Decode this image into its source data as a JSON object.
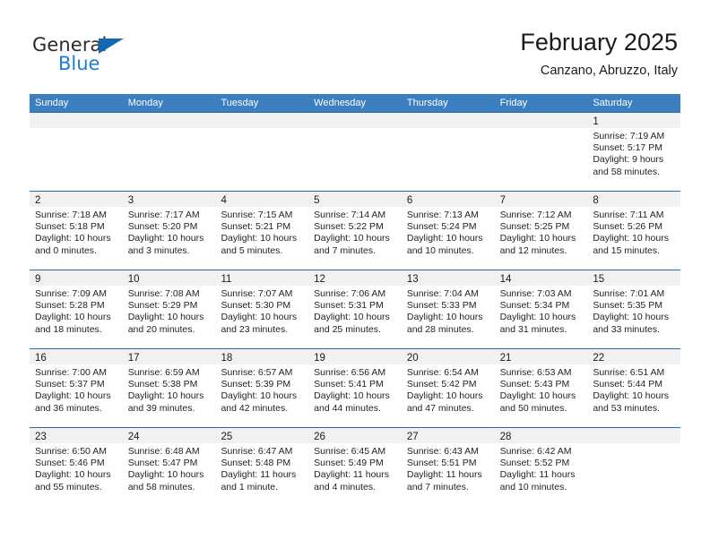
{
  "brand": {
    "name_top": "General",
    "name_bottom": "Blue",
    "triangle_color": "#1268b3",
    "blue_color": "#1a7fd4"
  },
  "header": {
    "title": "February 2025",
    "subtitle": "Canzano, Abruzzo, Italy"
  },
  "theme": {
    "header_blue": "#3c7fc1",
    "row_divider_blue": "#2b6ca8",
    "day_band_gray": "#f1f1f1"
  },
  "weekdays": [
    "Sunday",
    "Monday",
    "Tuesday",
    "Wednesday",
    "Thursday",
    "Friday",
    "Saturday"
  ],
  "weeks": [
    [
      {
        "day": "",
        "sunrise": "",
        "sunset": "",
        "daylight_line1": "",
        "daylight_line2": ""
      },
      {
        "day": "",
        "sunrise": "",
        "sunset": "",
        "daylight_line1": "",
        "daylight_line2": ""
      },
      {
        "day": "",
        "sunrise": "",
        "sunset": "",
        "daylight_line1": "",
        "daylight_line2": ""
      },
      {
        "day": "",
        "sunrise": "",
        "sunset": "",
        "daylight_line1": "",
        "daylight_line2": ""
      },
      {
        "day": "",
        "sunrise": "",
        "sunset": "",
        "daylight_line1": "",
        "daylight_line2": ""
      },
      {
        "day": "",
        "sunrise": "",
        "sunset": "",
        "daylight_line1": "",
        "daylight_line2": ""
      },
      {
        "day": "1",
        "sunrise": "Sunrise: 7:19 AM",
        "sunset": "Sunset: 5:17 PM",
        "daylight_line1": "Daylight: 9 hours",
        "daylight_line2": "and 58 minutes."
      }
    ],
    [
      {
        "day": "2",
        "sunrise": "Sunrise: 7:18 AM",
        "sunset": "Sunset: 5:18 PM",
        "daylight_line1": "Daylight: 10 hours",
        "daylight_line2": "and 0 minutes."
      },
      {
        "day": "3",
        "sunrise": "Sunrise: 7:17 AM",
        "sunset": "Sunset: 5:20 PM",
        "daylight_line1": "Daylight: 10 hours",
        "daylight_line2": "and 3 minutes."
      },
      {
        "day": "4",
        "sunrise": "Sunrise: 7:15 AM",
        "sunset": "Sunset: 5:21 PM",
        "daylight_line1": "Daylight: 10 hours",
        "daylight_line2": "and 5 minutes."
      },
      {
        "day": "5",
        "sunrise": "Sunrise: 7:14 AM",
        "sunset": "Sunset: 5:22 PM",
        "daylight_line1": "Daylight: 10 hours",
        "daylight_line2": "and 7 minutes."
      },
      {
        "day": "6",
        "sunrise": "Sunrise: 7:13 AM",
        "sunset": "Sunset: 5:24 PM",
        "daylight_line1": "Daylight: 10 hours",
        "daylight_line2": "and 10 minutes."
      },
      {
        "day": "7",
        "sunrise": "Sunrise: 7:12 AM",
        "sunset": "Sunset: 5:25 PM",
        "daylight_line1": "Daylight: 10 hours",
        "daylight_line2": "and 12 minutes."
      },
      {
        "day": "8",
        "sunrise": "Sunrise: 7:11 AM",
        "sunset": "Sunset: 5:26 PM",
        "daylight_line1": "Daylight: 10 hours",
        "daylight_line2": "and 15 minutes."
      }
    ],
    [
      {
        "day": "9",
        "sunrise": "Sunrise: 7:09 AM",
        "sunset": "Sunset: 5:28 PM",
        "daylight_line1": "Daylight: 10 hours",
        "daylight_line2": "and 18 minutes."
      },
      {
        "day": "10",
        "sunrise": "Sunrise: 7:08 AM",
        "sunset": "Sunset: 5:29 PM",
        "daylight_line1": "Daylight: 10 hours",
        "daylight_line2": "and 20 minutes."
      },
      {
        "day": "11",
        "sunrise": "Sunrise: 7:07 AM",
        "sunset": "Sunset: 5:30 PM",
        "daylight_line1": "Daylight: 10 hours",
        "daylight_line2": "and 23 minutes."
      },
      {
        "day": "12",
        "sunrise": "Sunrise: 7:06 AM",
        "sunset": "Sunset: 5:31 PM",
        "daylight_line1": "Daylight: 10 hours",
        "daylight_line2": "and 25 minutes."
      },
      {
        "day": "13",
        "sunrise": "Sunrise: 7:04 AM",
        "sunset": "Sunset: 5:33 PM",
        "daylight_line1": "Daylight: 10 hours",
        "daylight_line2": "and 28 minutes."
      },
      {
        "day": "14",
        "sunrise": "Sunrise: 7:03 AM",
        "sunset": "Sunset: 5:34 PM",
        "daylight_line1": "Daylight: 10 hours",
        "daylight_line2": "and 31 minutes."
      },
      {
        "day": "15",
        "sunrise": "Sunrise: 7:01 AM",
        "sunset": "Sunset: 5:35 PM",
        "daylight_line1": "Daylight: 10 hours",
        "daylight_line2": "and 33 minutes."
      }
    ],
    [
      {
        "day": "16",
        "sunrise": "Sunrise: 7:00 AM",
        "sunset": "Sunset: 5:37 PM",
        "daylight_line1": "Daylight: 10 hours",
        "daylight_line2": "and 36 minutes."
      },
      {
        "day": "17",
        "sunrise": "Sunrise: 6:59 AM",
        "sunset": "Sunset: 5:38 PM",
        "daylight_line1": "Daylight: 10 hours",
        "daylight_line2": "and 39 minutes."
      },
      {
        "day": "18",
        "sunrise": "Sunrise: 6:57 AM",
        "sunset": "Sunset: 5:39 PM",
        "daylight_line1": "Daylight: 10 hours",
        "daylight_line2": "and 42 minutes."
      },
      {
        "day": "19",
        "sunrise": "Sunrise: 6:56 AM",
        "sunset": "Sunset: 5:41 PM",
        "daylight_line1": "Daylight: 10 hours",
        "daylight_line2": "and 44 minutes."
      },
      {
        "day": "20",
        "sunrise": "Sunrise: 6:54 AM",
        "sunset": "Sunset: 5:42 PM",
        "daylight_line1": "Daylight: 10 hours",
        "daylight_line2": "and 47 minutes."
      },
      {
        "day": "21",
        "sunrise": "Sunrise: 6:53 AM",
        "sunset": "Sunset: 5:43 PM",
        "daylight_line1": "Daylight: 10 hours",
        "daylight_line2": "and 50 minutes."
      },
      {
        "day": "22",
        "sunrise": "Sunrise: 6:51 AM",
        "sunset": "Sunset: 5:44 PM",
        "daylight_line1": "Daylight: 10 hours",
        "daylight_line2": "and 53 minutes."
      }
    ],
    [
      {
        "day": "23",
        "sunrise": "Sunrise: 6:50 AM",
        "sunset": "Sunset: 5:46 PM",
        "daylight_line1": "Daylight: 10 hours",
        "daylight_line2": "and 55 minutes."
      },
      {
        "day": "24",
        "sunrise": "Sunrise: 6:48 AM",
        "sunset": "Sunset: 5:47 PM",
        "daylight_line1": "Daylight: 10 hours",
        "daylight_line2": "and 58 minutes."
      },
      {
        "day": "25",
        "sunrise": "Sunrise: 6:47 AM",
        "sunset": "Sunset: 5:48 PM",
        "daylight_line1": "Daylight: 11 hours",
        "daylight_line2": "and 1 minute."
      },
      {
        "day": "26",
        "sunrise": "Sunrise: 6:45 AM",
        "sunset": "Sunset: 5:49 PM",
        "daylight_line1": "Daylight: 11 hours",
        "daylight_line2": "and 4 minutes."
      },
      {
        "day": "27",
        "sunrise": "Sunrise: 6:43 AM",
        "sunset": "Sunset: 5:51 PM",
        "daylight_line1": "Daylight: 11 hours",
        "daylight_line2": "and 7 minutes."
      },
      {
        "day": "28",
        "sunrise": "Sunrise: 6:42 AM",
        "sunset": "Sunset: 5:52 PM",
        "daylight_line1": "Daylight: 11 hours",
        "daylight_line2": "and 10 minutes."
      },
      {
        "day": "",
        "sunrise": "",
        "sunset": "",
        "daylight_line1": "",
        "daylight_line2": ""
      }
    ]
  ]
}
